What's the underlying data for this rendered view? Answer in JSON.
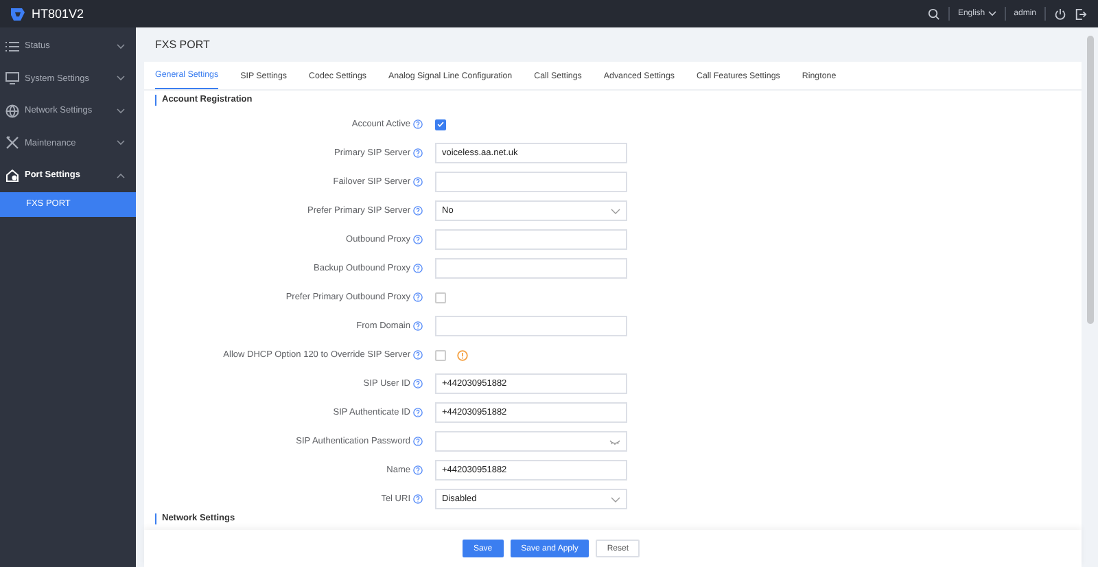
{
  "header": {
    "product": "HT801V2",
    "language": "English",
    "user": "admin"
  },
  "sidebar": {
    "items": [
      {
        "label": "Status",
        "expanded": false
      },
      {
        "label": "System Settings",
        "expanded": false
      },
      {
        "label": "Network Settings",
        "expanded": false
      },
      {
        "label": "Maintenance",
        "expanded": false
      },
      {
        "label": "Port Settings",
        "expanded": true,
        "children": [
          {
            "label": "FXS PORT",
            "selected": true
          }
        ]
      }
    ]
  },
  "page_title": "FXS PORT",
  "tabs": [
    {
      "label": "General Settings",
      "selected": true
    },
    {
      "label": "SIP Settings",
      "selected": false
    },
    {
      "label": "Codec Settings",
      "selected": false
    },
    {
      "label": "Analog Signal Line Configuration",
      "selected": false
    },
    {
      "label": "Call Settings",
      "selected": false
    },
    {
      "label": "Advanced Settings",
      "selected": false
    },
    {
      "label": "Call Features Settings",
      "selected": false
    },
    {
      "label": "Ringtone",
      "selected": false
    }
  ],
  "sections": [
    {
      "title": "Account Registration",
      "fields": [
        {
          "label": "Account Active",
          "kind": "checkbox",
          "checked": true
        },
        {
          "label": "Primary SIP Server",
          "kind": "text",
          "value": "voiceless.aa.net.uk"
        },
        {
          "label": "Failover SIP Server",
          "kind": "text"
        },
        {
          "label": "Prefer Primary SIP Server",
          "kind": "select",
          "value": "No"
        },
        {
          "label": "Outbound Proxy",
          "kind": "text"
        },
        {
          "label": "Backup Outbound Proxy",
          "kind": "text"
        },
        {
          "label": "Prefer Primary Outbound Proxy",
          "kind": "checkbox",
          "checked": false
        },
        {
          "label": "From Domain",
          "kind": "text"
        },
        {
          "label": "Allow DHCP Option 120 to Override SIP Server",
          "kind": "checkbox",
          "checked": false,
          "warning": true
        },
        {
          "label": "SIP User ID",
          "kind": "text",
          "value": "+442030951882"
        },
        {
          "label": "SIP Authenticate ID",
          "kind": "text",
          "value": "+442030951882"
        },
        {
          "label": "SIP Authentication Password",
          "kind": "password"
        },
        {
          "label": "Name",
          "kind": "text",
          "value": "+442030951882"
        },
        {
          "label": "Tel URI",
          "kind": "select",
          "value": "Disabled"
        }
      ]
    },
    {
      "title": "Network Settings"
    }
  ],
  "buttons": [
    {
      "label": "Save",
      "kind": "primary"
    },
    {
      "label": "Save and Apply",
      "kind": "primary"
    },
    {
      "label": "Reset",
      "kind": "plain"
    }
  ]
}
